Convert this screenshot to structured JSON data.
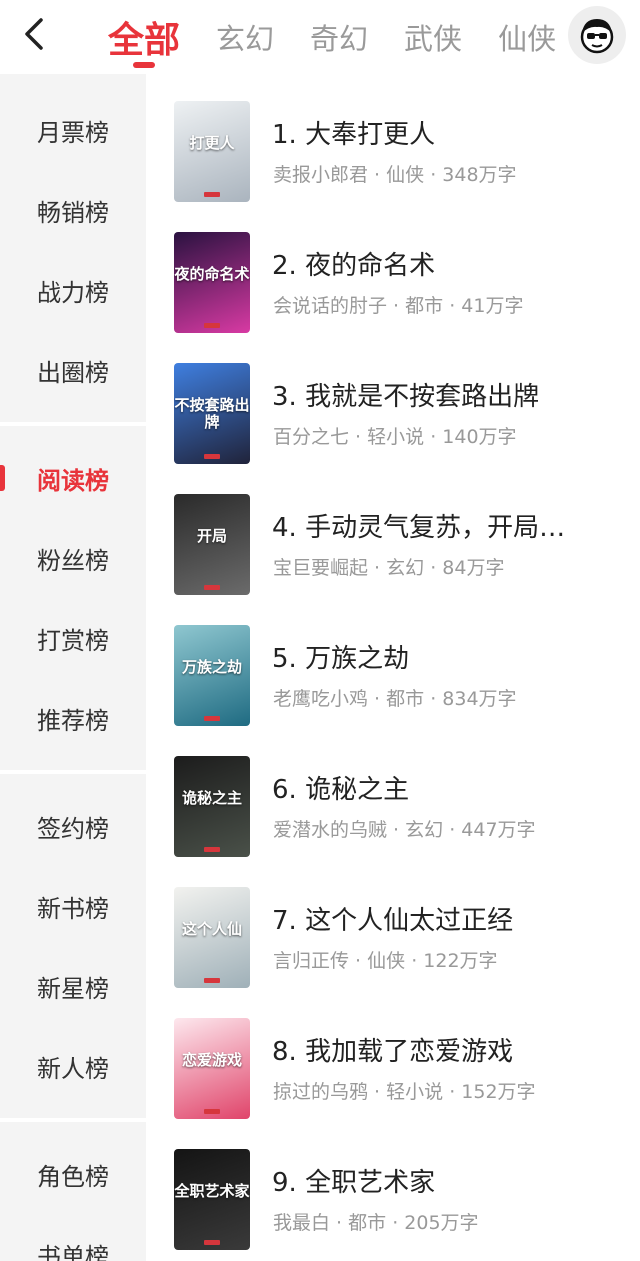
{
  "header": {
    "tabs": [
      {
        "label": "全部",
        "active": true
      },
      {
        "label": "玄幻",
        "active": false
      },
      {
        "label": "奇幻",
        "active": false
      },
      {
        "label": "武侠",
        "active": false
      },
      {
        "label": "仙侠",
        "active": false
      }
    ]
  },
  "sidebar": {
    "groups": [
      [
        "月票榜",
        "畅销榜",
        "战力榜",
        "出圈榜"
      ],
      [
        "阅读榜",
        "粉丝榜",
        "打赏榜",
        "推荐榜"
      ],
      [
        "签约榜",
        "新书榜",
        "新星榜",
        "新人榜"
      ],
      [
        "角色榜",
        "书单榜"
      ]
    ],
    "active": "阅读榜"
  },
  "books": [
    {
      "title": "1. 大奉打更人",
      "author": "卖报小郎君",
      "genre": "仙侠",
      "words": "348万字",
      "cover_text": "打更人",
      "cover_colors": [
        "#eef1f3",
        "#aab4be"
      ]
    },
    {
      "title": "2. 夜的命名术",
      "author": "会说话的肘子",
      "genre": "都市",
      "words": "41万字",
      "cover_text": "夜的命名术",
      "cover_colors": [
        "#2a1240",
        "#d83aa3"
      ]
    },
    {
      "title": "3. 我就是不按套路出牌",
      "author": "百分之七",
      "genre": "轻小说",
      "words": "140万字",
      "cover_text": "不按套路出牌",
      "cover_colors": [
        "#3f7fe0",
        "#20233a"
      ]
    },
    {
      "title": "4. 手动灵气复苏，开局…",
      "author": "宝巨要崛起",
      "genre": "玄幻",
      "words": "84万字",
      "cover_text": "开局",
      "cover_colors": [
        "#2a2a2a",
        "#6b6b6b"
      ]
    },
    {
      "title": "5. 万族之劫",
      "author": "老鹰吃小鸡",
      "genre": "都市",
      "words": "834万字",
      "cover_text": "万族之劫",
      "cover_colors": [
        "#8fc7d0",
        "#1f6b82"
      ]
    },
    {
      "title": "6. 诡秘之主",
      "author": "爱潜水的乌贼",
      "genre": "玄幻",
      "words": "447万字",
      "cover_text": "诡秘之主",
      "cover_colors": [
        "#1c1c1c",
        "#4a5149"
      ]
    },
    {
      "title": "7. 这个人仙太过正经",
      "author": "言归正传",
      "genre": "仙侠",
      "words": "122万字",
      "cover_text": "这个人仙",
      "cover_colors": [
        "#f2f2ef",
        "#9fb0b8"
      ]
    },
    {
      "title": "8. 我加载了恋爱游戏",
      "author": "掠过的乌鸦",
      "genre": "轻小说",
      "words": "152万字",
      "cover_text": "恋爱游戏",
      "cover_colors": [
        "#fde8ee",
        "#e0446a"
      ]
    },
    {
      "title": "9. 全职艺术家",
      "author": "我最白",
      "genre": "都市",
      "words": "205万字",
      "cover_text": "全职艺术家",
      "cover_colors": [
        "#141414",
        "#3a3a3a"
      ]
    }
  ],
  "colors": {
    "accent": "#e8343b",
    "sidebar_bg": "#f4f4f4",
    "meta_text": "#999999"
  },
  "icons": {
    "back": "chevron-left-icon",
    "avatar": "user-avatar-icon"
  }
}
